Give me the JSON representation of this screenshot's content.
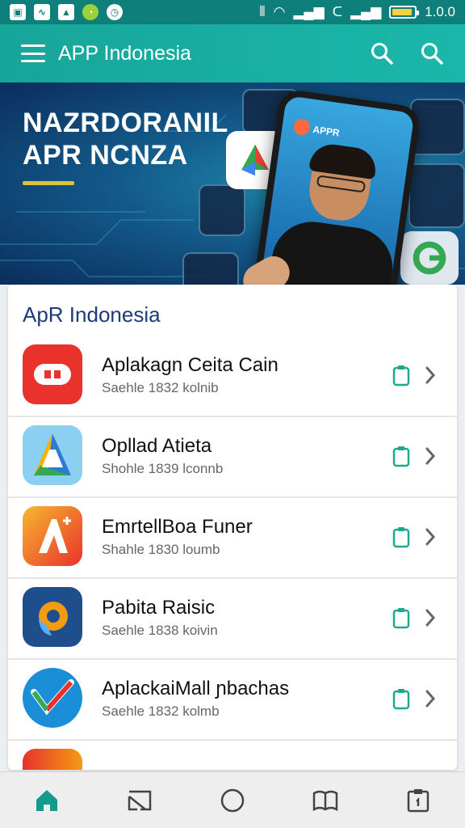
{
  "status_bar": {
    "left_icons": [
      "image-icon",
      "chart-icon",
      "photo-icon",
      "whatsapp-icon",
      "speed-icon"
    ],
    "right_icons": [
      "vibrate-icon",
      "wifi-icon",
      "signal-icon",
      "call-icon",
      "signal-icon"
    ],
    "battery_level": 0.9,
    "time": "1.0.0"
  },
  "app_bar": {
    "title": "APP Indonesia",
    "menu_icon": "menu-icon",
    "action_icons": [
      "search-icon",
      "search-icon"
    ],
    "background": "#17a59a"
  },
  "banner": {
    "title_line1": "NAZRDORANIL",
    "title_line2": "APR NCNZA",
    "phone_label": "APPR",
    "accent": "#d9c53a"
  },
  "list": {
    "title": "ApR Indonesia",
    "items": [
      {
        "name": "Aplakagn Ceita Cain",
        "meta": "Saehle 1832 kolnib",
        "icon": "camera-app-icon",
        "color": "#e8322b"
      },
      {
        "name": "Opllad Atieta",
        "meta": "Shohle 1839 lconnb",
        "icon": "drive-app-icon",
        "color": "#2f7ad9"
      },
      {
        "name": "EmrtellBoa Funer",
        "meta": "Shahle 1830 loumb",
        "icon": "a-app-icon",
        "color": "#f3642a"
      },
      {
        "name": "Pabita Raisic",
        "meta": "Saehle 1838 koivin",
        "icon": "gear-app-icon",
        "color": "#1f4e8c"
      },
      {
        "name": "AplackaiMall ɲbachas",
        "meta": "Saehle 1832 kolmb",
        "icon": "check-app-icon",
        "color": "#1a8fd8"
      }
    ]
  },
  "bottom_nav": {
    "items": [
      "home-icon",
      "cast-icon",
      "circle-icon",
      "book-icon",
      "clipboard-icon"
    ],
    "active": 0,
    "active_color": "#159a8e"
  }
}
